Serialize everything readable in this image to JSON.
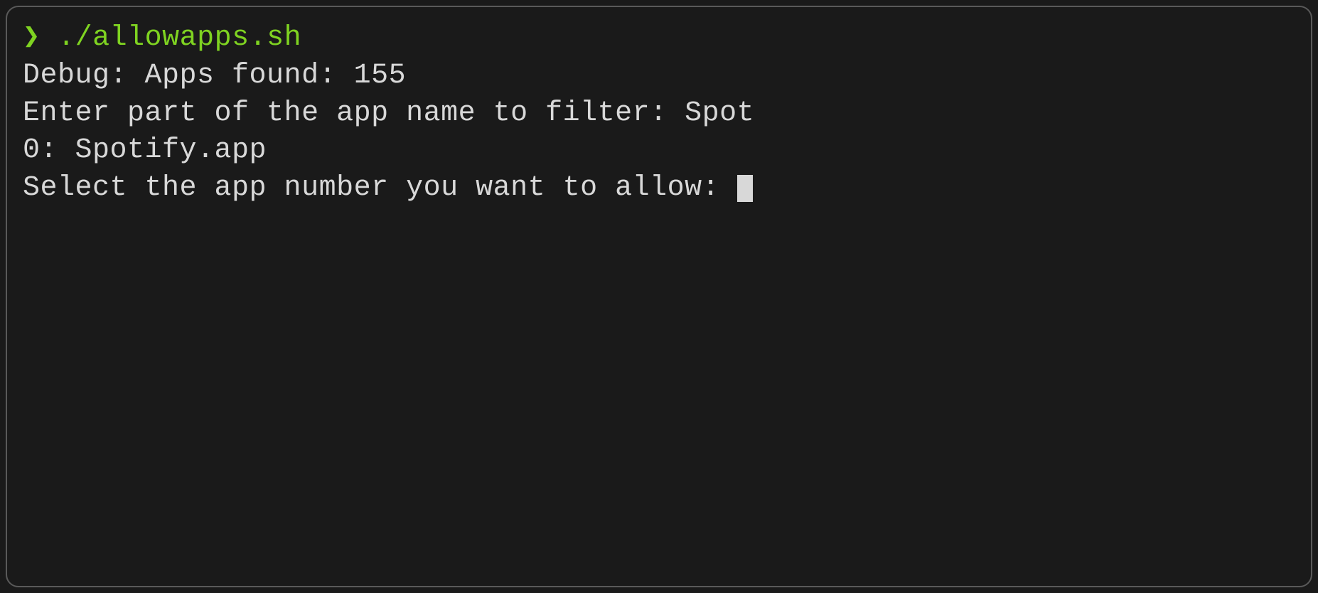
{
  "terminal": {
    "prompt_symbol": "❯",
    "command": "./allowapps.sh",
    "lines": {
      "debug": "Debug: Apps found: 155",
      "filter_prompt": "Enter part of the app name to filter: ",
      "filter_input": "Spot",
      "result_0": "0: Spotify.app",
      "select_prompt": "Select the app number you want to allow: "
    }
  }
}
